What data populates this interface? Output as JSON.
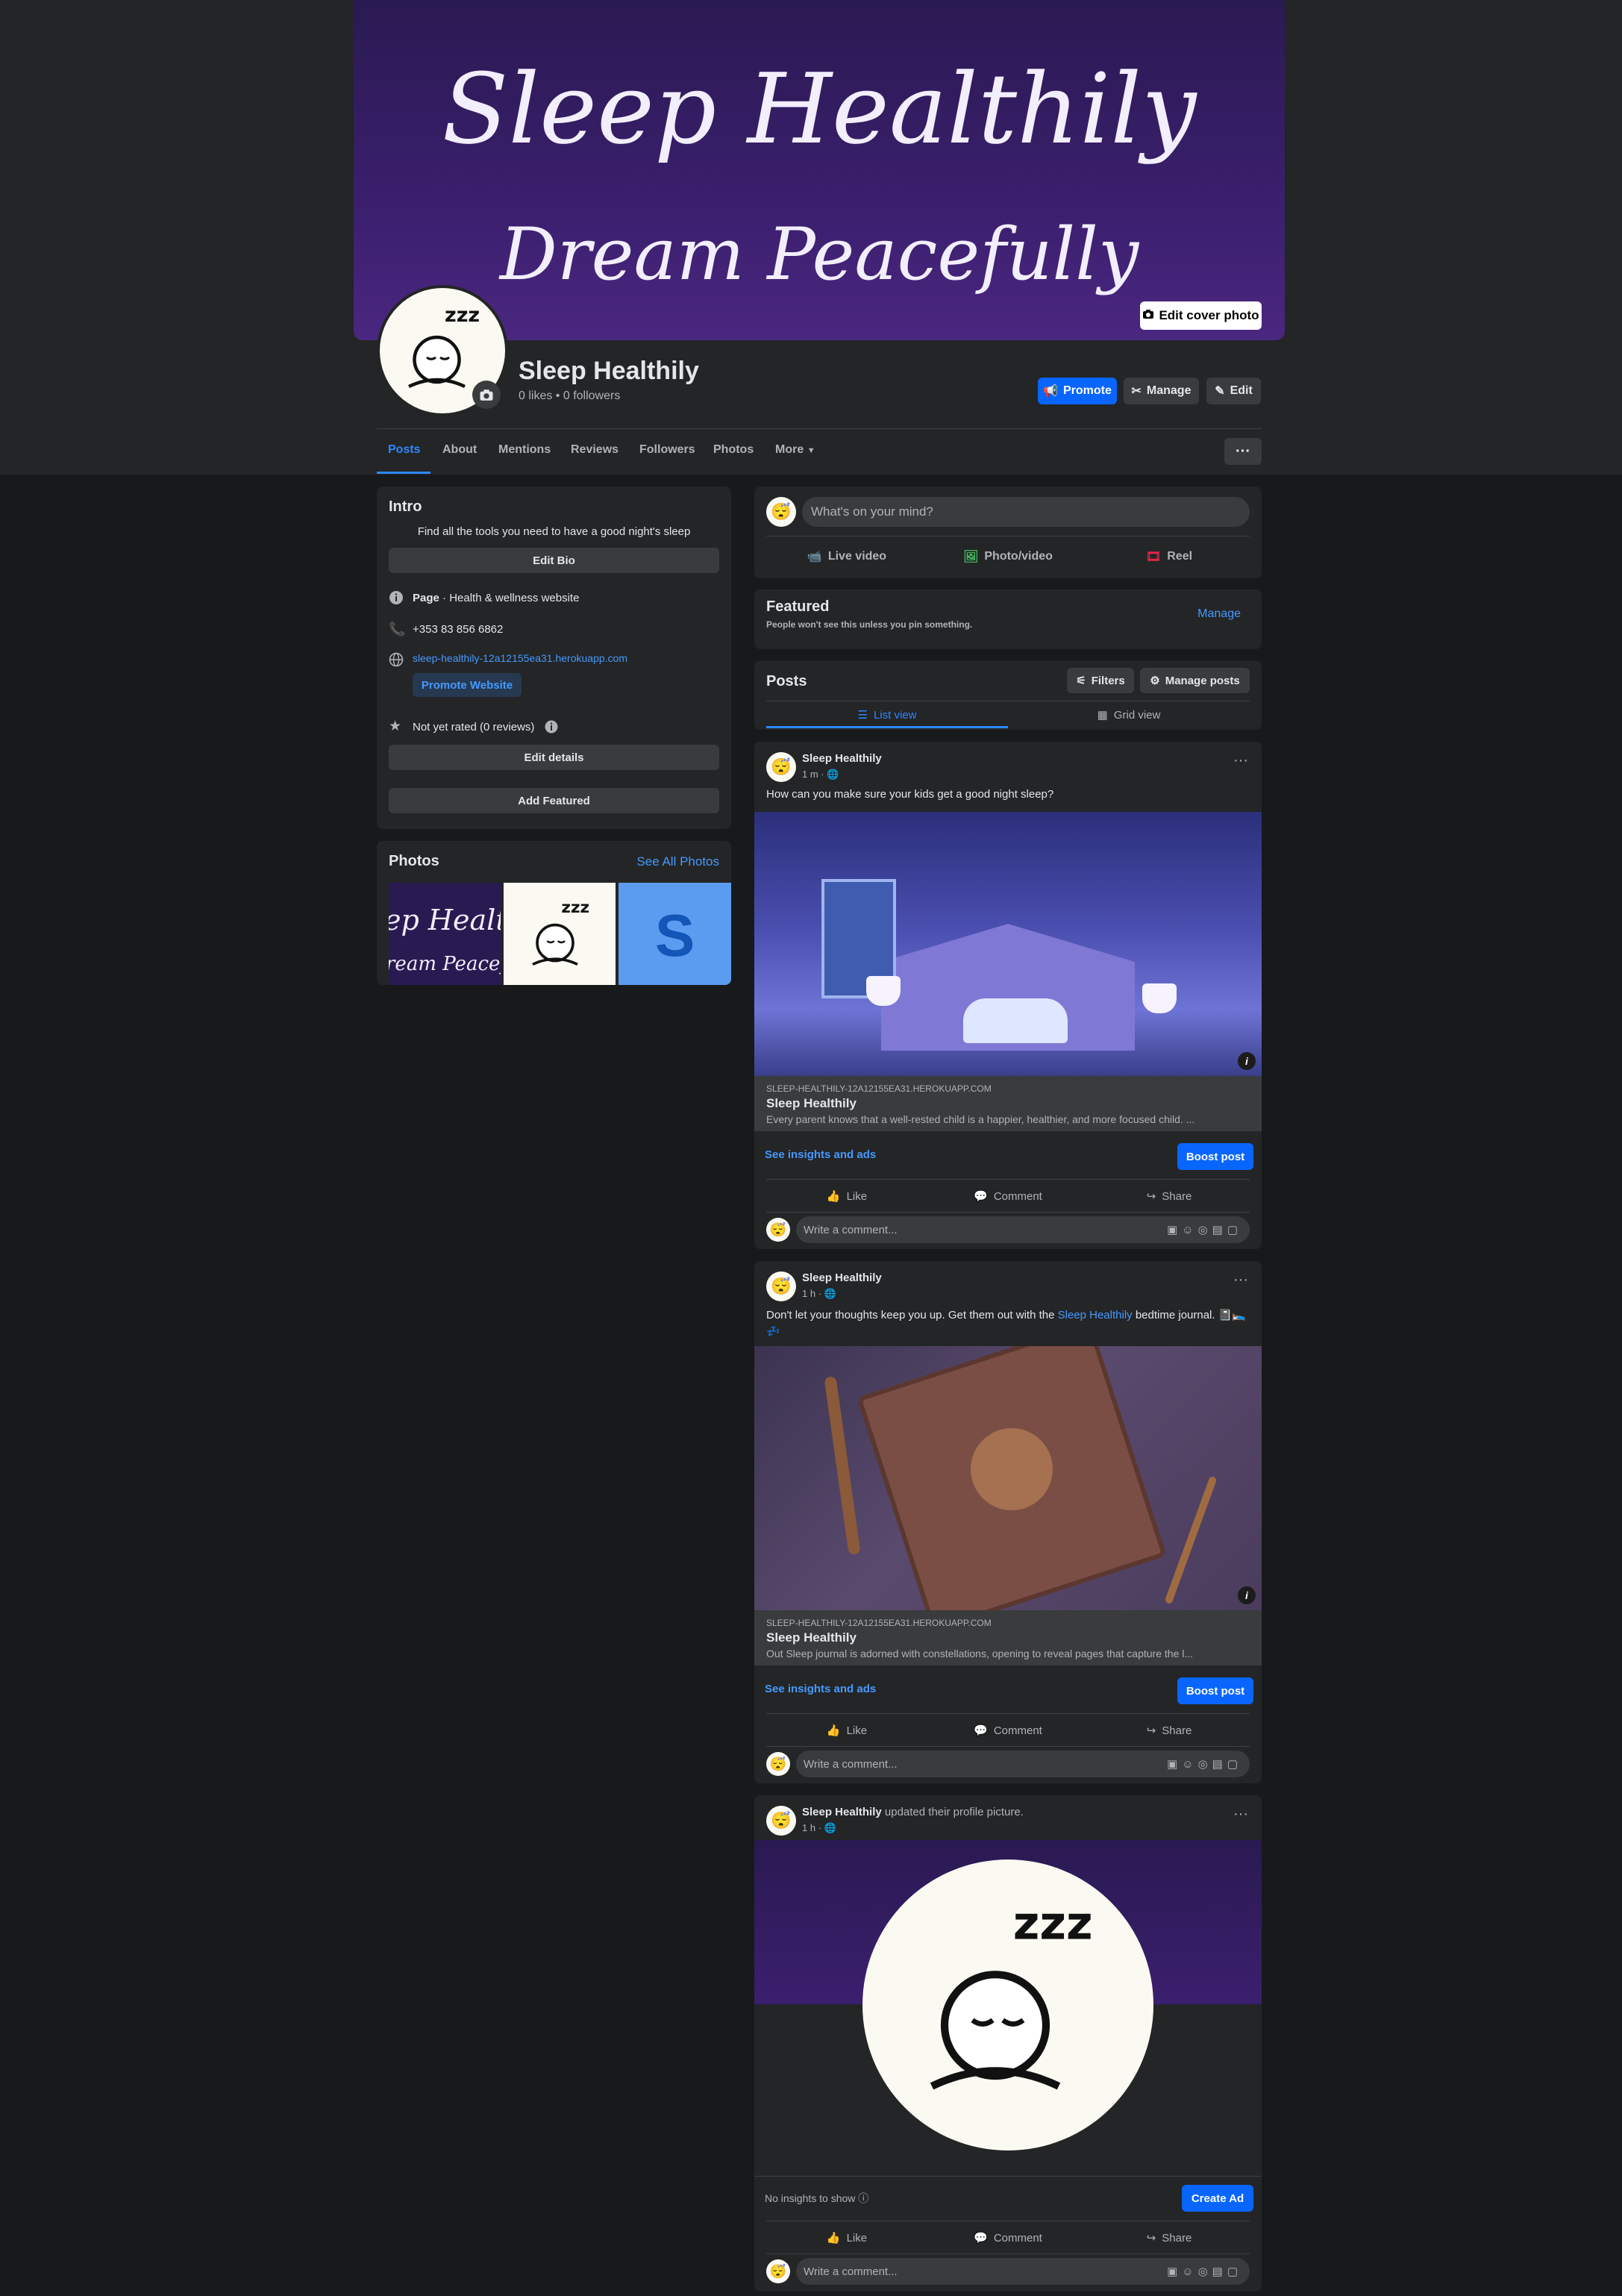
{
  "cover": {
    "line1": "Sleep Healthily",
    "line2": "Dream Peacefully",
    "edit_label": "Edit cover photo"
  },
  "profile": {
    "name": "Sleep Healthily",
    "stats": "0 likes • 0 followers",
    "promote_label": "Promote",
    "manage_label": "Manage",
    "edit_label": "Edit"
  },
  "tabs": [
    "Posts",
    "About",
    "Mentions",
    "Reviews",
    "Followers",
    "Photos",
    "More"
  ],
  "intro": {
    "title": "Intro",
    "bio": "Find all the tools you need to have a good night's sleep",
    "edit_bio": "Edit Bio",
    "page_label": "Page",
    "category": " · Health & wellness website",
    "phone": "+353 83 856 6862",
    "website": "sleep-healthily-12a12155ea31.herokuapp.com",
    "promote_website": "Promote Website",
    "rating": "Not yet rated (0 reviews)",
    "edit_details": "Edit details",
    "add_featured": "Add Featured"
  },
  "photos": {
    "title": "Photos",
    "see_all": "See All Photos",
    "thumb1_text": "ep Healthi",
    "thumb1_text2": "ream Peacefull",
    "thumb3_letter": "S"
  },
  "composer": {
    "placeholder": "What's on your mind?",
    "live": "Live video",
    "photo": "Photo/video",
    "reel": "Reel"
  },
  "featured": {
    "title": "Featured",
    "subtitle": "People won't see this unless you pin something.",
    "manage": "Manage"
  },
  "posts_header": {
    "title": "Posts",
    "filters": "Filters",
    "manage_posts": "Manage posts",
    "list_view": "List view",
    "grid_view": "Grid view"
  },
  "posts": [
    {
      "author": "Sleep Healthily",
      "time": "1 m · ",
      "text": "How can you make sure your kids get a good night sleep?",
      "link_domain": "SLEEP-HEALTHILY-12A12155EA31.HEROKUAPP.COM",
      "link_title": "Sleep Healthily",
      "link_desc": "Every parent knows that a well-rested child is a happier, healthier, and more focused child. ...",
      "insights": "See insights and ads",
      "boost": "Boost post"
    },
    {
      "author": "Sleep Healthily",
      "time": "1 h · ",
      "text_before": "Don't let your thoughts keep you up. Get them out with the ",
      "text_link": "Sleep Healthily",
      "text_after": " bedtime journal. 📓🛌💤",
      "link_domain": "SLEEP-HEALTHILY-12A12155EA31.HEROKUAPP.COM",
      "link_title": "Sleep Healthily",
      "link_desc": "Out Sleep journal is adorned with constellations, opening to reveal pages that capture the l...",
      "insights": "See insights and ads",
      "boost": "Boost post"
    },
    {
      "author": "Sleep Healthily",
      "action": " updated their profile picture.",
      "time": "1 h · ",
      "no_insights": "No insights to show",
      "create_ad": "Create Ad"
    }
  ],
  "actions": {
    "like": "Like",
    "comment": "Comment",
    "share": "Share",
    "write_comment": "Write a comment..."
  },
  "colors": {
    "accent": "#0866ff",
    "link": "#4599ff",
    "background": "#18191a",
    "card": "#242526"
  }
}
